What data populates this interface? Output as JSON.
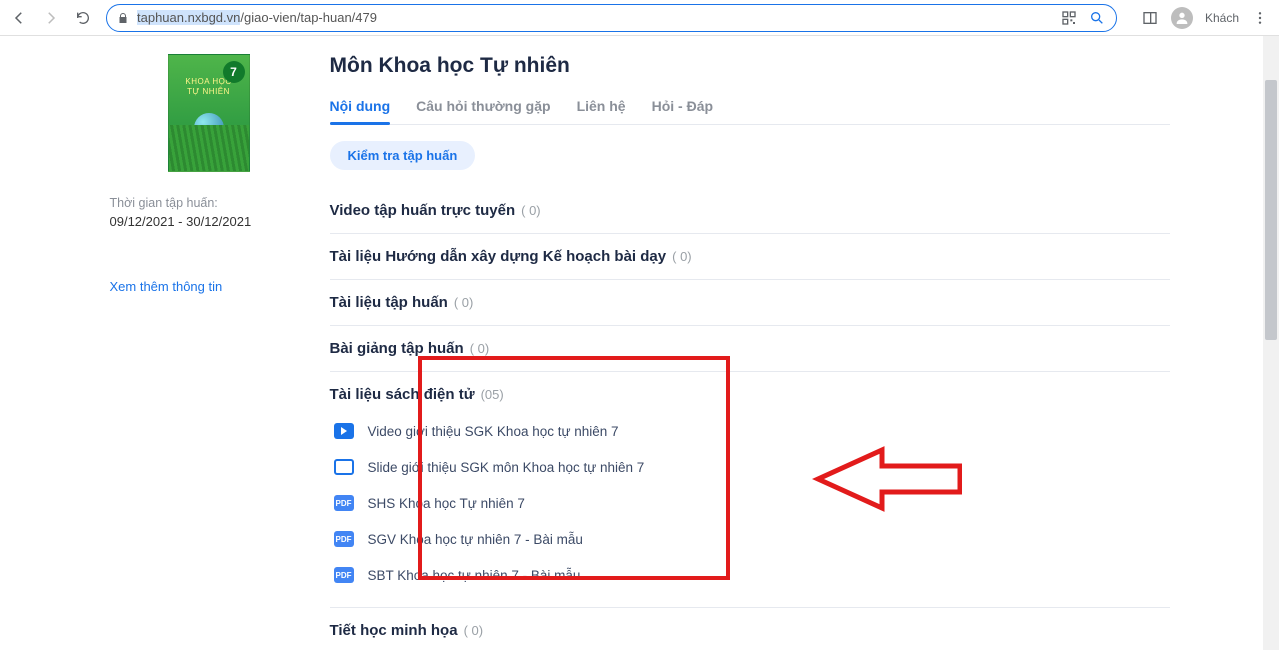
{
  "browser": {
    "url_selected": "taphuan.nxbgd.vn",
    "url_rest": "/giao-vien/tap-huan/479",
    "guest_label": "Khách"
  },
  "sidebar": {
    "cover_line1": "KHOA HỌC",
    "cover_line2": "TỰ NHIÊN",
    "cover_number": "7",
    "time_label": "Thời gian tập huấn:",
    "time_value": "09/12/2021 - 30/12/2021",
    "more": "Xem thêm thông tin"
  },
  "main": {
    "title": "Môn Khoa học Tự nhiên",
    "tabs": [
      {
        "label": "Nội dung",
        "active": true
      },
      {
        "label": "Câu hỏi thường gặp",
        "active": false
      },
      {
        "label": "Liên hệ",
        "active": false
      },
      {
        "label": "Hỏi - Đáp",
        "active": false
      }
    ],
    "chip": "Kiểm tra tập huấn",
    "sections": [
      {
        "title": "Video tập huấn trực tuyến",
        "count": "( 0)",
        "items": []
      },
      {
        "title": "Tài liệu Hướng dẫn xây dựng Kế hoạch bài dạy",
        "count": "( 0)",
        "items": []
      },
      {
        "title": "Tài liệu tập huấn",
        "count": "( 0)",
        "items": []
      },
      {
        "title": "Bài giảng tập huấn",
        "count": "( 0)",
        "items": []
      },
      {
        "title": "Tài liệu sách điện tử",
        "count": "(05)",
        "items": [
          {
            "icon": "video",
            "label": "Video giới thiệu SGK Khoa học tự nhiên 7"
          },
          {
            "icon": "slide",
            "label": "Slide giới thiệu SGK môn Khoa học tự nhiên 7"
          },
          {
            "icon": "pdf",
            "label": "SHS Khoa học Tự nhiên 7"
          },
          {
            "icon": "pdf",
            "label": "SGV Khoa học tự nhiên 7 - Bài mẫu"
          },
          {
            "icon": "pdf",
            "label": "SBT Khoa học tự nhiên 7 - Bài mẫu"
          }
        ]
      },
      {
        "title": "Tiết học minh họa",
        "count": "( 0)",
        "items": []
      }
    ]
  },
  "pdf_tag": "PDF"
}
